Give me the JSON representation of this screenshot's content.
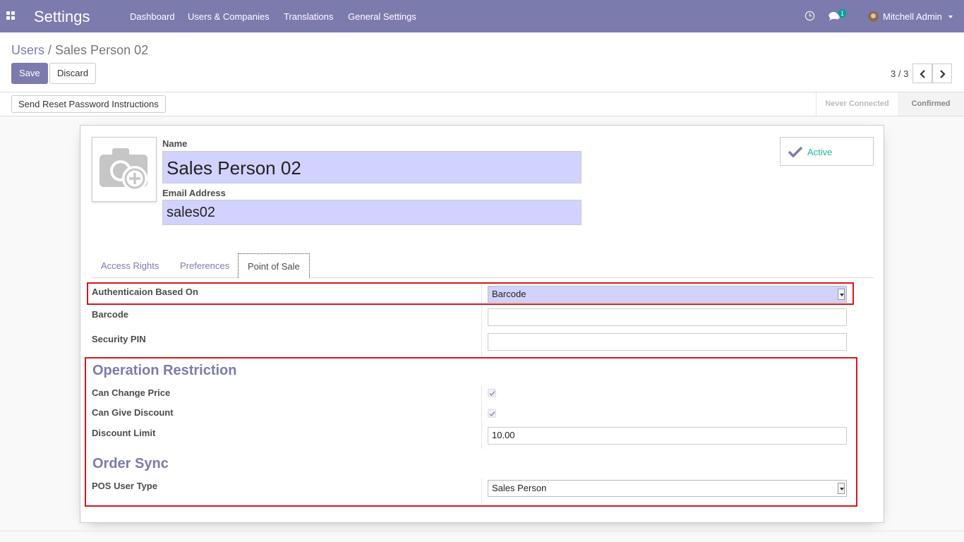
{
  "navbar": {
    "app_title": "Settings",
    "menu": [
      "Dashboard",
      "Users & Companies",
      "Translations",
      "General Settings"
    ],
    "message_count": "1",
    "user_name": "Mitchell Admin",
    "icons": [
      "apps-grid-icon",
      "clock-icon",
      "chat-icon",
      "avatar",
      "caret-down-icon"
    ]
  },
  "breadcrumb": {
    "parent": "Users",
    "separator": "/",
    "current": "Sales Person 02"
  },
  "buttons": {
    "save": "Save",
    "discard": "Discard"
  },
  "pager": {
    "value": "3 / 3"
  },
  "statusbar": {
    "reset_password": "Send Reset Password Instructions",
    "stages": [
      "Never Connected",
      "Confirmed"
    ],
    "current_stage": "Confirmed"
  },
  "form": {
    "name_label": "Name",
    "name_value": "Sales Person 02",
    "email_label": "Email Address",
    "email_value": "sales02",
    "active_label": "Active",
    "tabs": [
      "Access Rights",
      "Preferences",
      "Point of Sale"
    ],
    "active_tab": "Point of Sale",
    "pos": {
      "auth_label": "Authenticaion Based On",
      "auth_value": "Barcode",
      "barcode_label": "Barcode",
      "barcode_value": "",
      "pin_label": "Security PIN",
      "pin_value": "",
      "operation_title": "Operation Restriction",
      "change_price_label": "Can Change Price",
      "change_price_checked": true,
      "give_discount_label": "Can Give Discount",
      "give_discount_checked": true,
      "discount_limit_label": "Discount Limit",
      "discount_limit_value": "10.00",
      "order_sync_title": "Order Sync",
      "pos_user_type_label": "POS User Type",
      "pos_user_type_value": "Sales Person"
    }
  },
  "colors": {
    "brand": "#7c7bad",
    "highlight_input": "#d2d2ff",
    "active_green": "#21b799",
    "annotation_red": "#d9161c"
  }
}
